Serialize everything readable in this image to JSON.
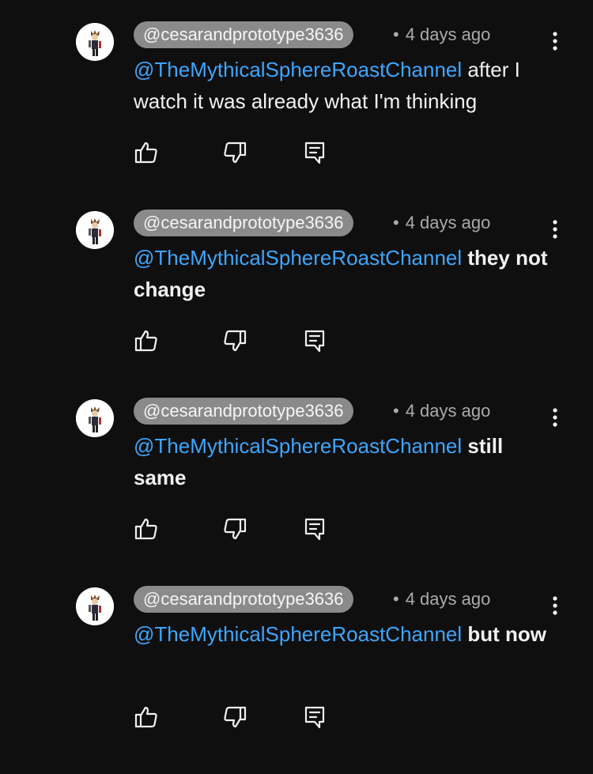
{
  "comments": [
    {
      "handle": "@cesarandprototype3636",
      "dot": "•",
      "time": "4 days ago",
      "mention": "@TheMythicalSphereRoastChannel",
      "text": " after I watch it was already what I'm thinking",
      "bold": false
    },
    {
      "handle": "@cesarandprototype3636",
      "dot": "•",
      "time": "4 days ago",
      "mention": "@TheMythicalSphereRoastChannel",
      "text": " they not change",
      "bold": true
    },
    {
      "handle": "@cesarandprototype3636",
      "dot": "•",
      "time": "4 days ago",
      "mention": "@TheMythicalSphereRoastChannel",
      "text": " still same",
      "bold": true
    },
    {
      "handle": "@cesarandprototype3636",
      "dot": "•",
      "time": "4 days ago",
      "mention": "@TheMythicalSphereRoastChannel",
      "text": " but now",
      "bold": true
    }
  ],
  "icons": {
    "avatar": "avatar-image",
    "like": "thumbs-up-icon",
    "dislike": "thumbs-down-icon",
    "reply": "reply-icon",
    "more": "more-vertical-icon"
  },
  "colors": {
    "background": "#0f0f0f",
    "mention": "#3ea6ff",
    "handle_pill": "#8a8a8a",
    "meta_text": "#aaaaaa"
  }
}
